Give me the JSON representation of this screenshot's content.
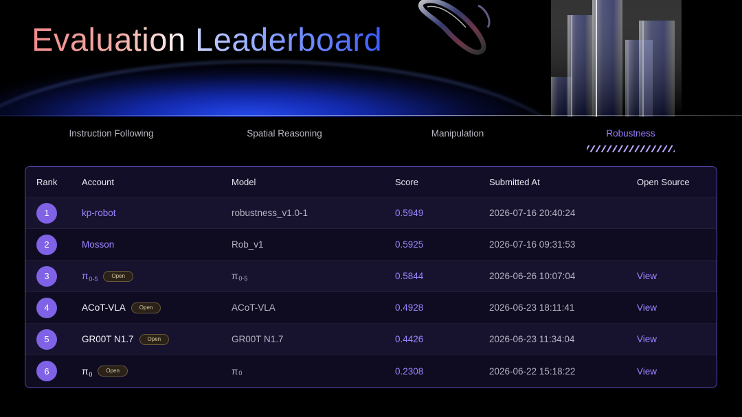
{
  "header": {
    "title_word1": "Evaluation",
    "title_word2": "Leaderboard"
  },
  "tabs": [
    {
      "label": "Instruction Following",
      "active": false
    },
    {
      "label": "Spatial Reasoning",
      "active": false
    },
    {
      "label": "Manipulation",
      "active": false
    },
    {
      "label": "Robustness",
      "active": true
    }
  ],
  "table": {
    "columns": [
      "Rank",
      "Account",
      "Model",
      "Score",
      "Submitted At",
      "Open Source"
    ],
    "open_tag_label": "Open",
    "view_label": "View",
    "rows": [
      {
        "rank": "1",
        "account": "kp-robot",
        "account_sub": "",
        "open": false,
        "model": "robustness_v1.0-1",
        "model_sub": "",
        "score": "0.5949",
        "submitted": "2026-07-16 20:40:24",
        "open_source": ""
      },
      {
        "rank": "2",
        "account": "Mosson",
        "account_sub": "",
        "open": false,
        "model": "Rob_v1",
        "model_sub": "",
        "score": "0.5925",
        "submitted": "2026-07-16 09:31:53",
        "open_source": ""
      },
      {
        "rank": "3",
        "account": "π",
        "account_sub": "0-5",
        "open": true,
        "model": "π",
        "model_sub": "0-5",
        "score": "0.5844",
        "submitted": "2026-06-26 10:07:04",
        "open_source": "View"
      },
      {
        "rank": "4",
        "account": "ACoT-VLA",
        "account_sub": "",
        "open": true,
        "model": "ACoT-VLA",
        "model_sub": "",
        "score": "0.4928",
        "submitted": "2026-06-23 18:11:41",
        "open_source": "View"
      },
      {
        "rank": "5",
        "account": "GR00T N1.7",
        "account_sub": "",
        "open": true,
        "model": "GR00T N1.7",
        "model_sub": "",
        "score": "0.4426",
        "submitted": "2026-06-23 11:34:04",
        "open_source": "View"
      },
      {
        "rank": "6",
        "account": "π",
        "account_sub": "0",
        "open": true,
        "model": "π",
        "model_sub": "0",
        "score": "0.2308",
        "submitted": "2026-06-22 15:18:22",
        "open_source": "View"
      }
    ]
  },
  "colors": {
    "accent": "#9d84ff",
    "rank_badge": "#7f62e6",
    "table_border": "#5b4bb5",
    "background": "#000000"
  }
}
